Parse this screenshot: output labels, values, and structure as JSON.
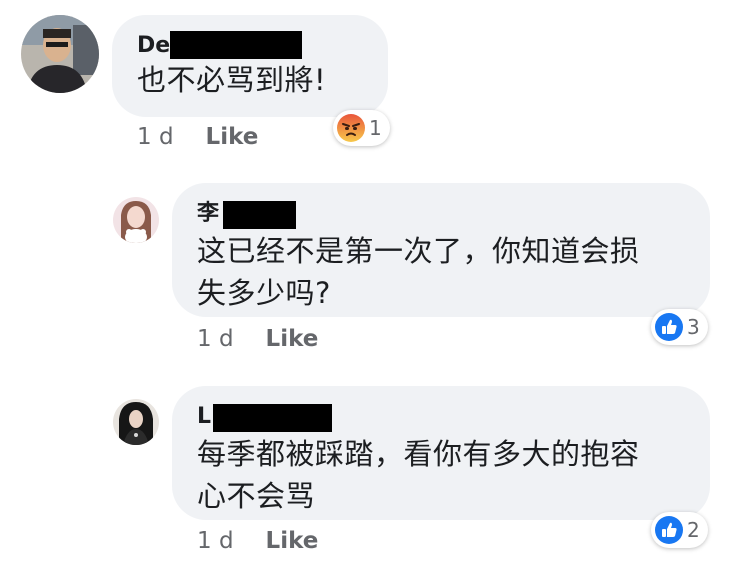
{
  "comments": [
    {
      "author_visible": "De",
      "text": "也不必骂到將!",
      "time": "1 d",
      "like_label": "Like",
      "reaction_type": "angry",
      "reaction_count": "1"
    },
    {
      "author_visible": "李",
      "text": "这已经不是第一次了，你知道会损\n失多少吗?",
      "time": "1 d",
      "like_label": "Like",
      "reaction_type": "like",
      "reaction_count": "3"
    },
    {
      "author_visible": "L",
      "text": "每季都被踩踏，看你有多大的抱容\n心不会骂",
      "time": "1 d",
      "like_label": "Like",
      "reaction_type": "like",
      "reaction_count": "2"
    }
  ],
  "colors": {
    "bubble": "#f0f2f5",
    "like_blue": "#1877f2",
    "meta_gray": "#65676b",
    "redaction": "#000000"
  }
}
